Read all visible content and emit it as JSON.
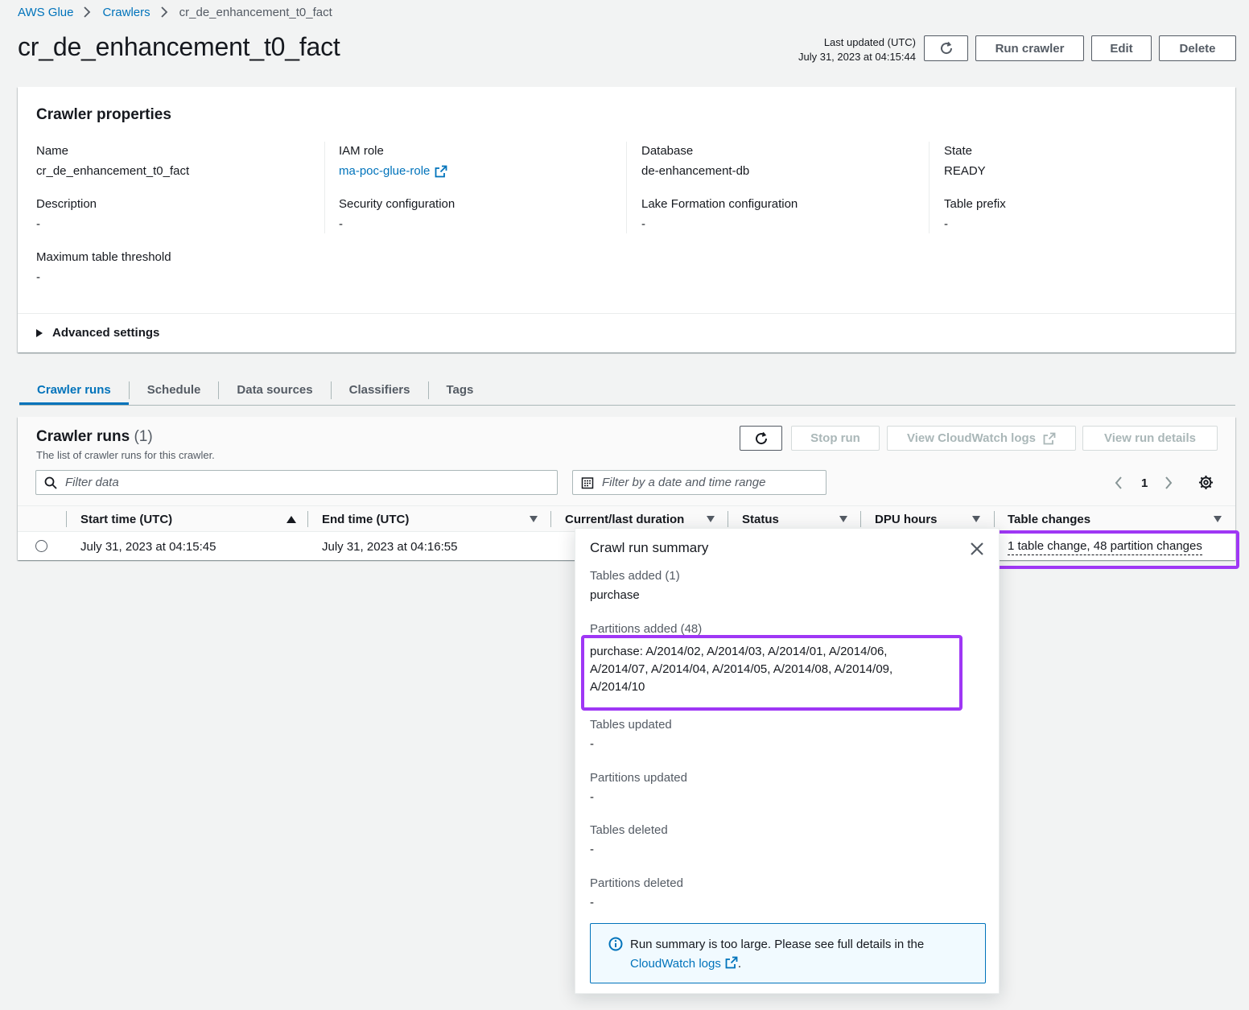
{
  "breadcrumb": {
    "root": "AWS Glue",
    "crawlers": "Crawlers",
    "current": "cr_de_enhancement_t0_fact"
  },
  "header": {
    "title": "cr_de_enhancement_t0_fact",
    "last_updated_label": "Last updated (UTC)",
    "last_updated_value": "July 31, 2023 at 04:15:44",
    "run_crawler": "Run crawler",
    "edit": "Edit",
    "delete": "Delete"
  },
  "properties": {
    "title": "Crawler properties",
    "name_label": "Name",
    "name_value": "cr_de_enhancement_t0_fact",
    "iam_label": "IAM role",
    "iam_value": "ma-poc-glue-role",
    "db_label": "Database",
    "db_value": "de-enhancement-db",
    "state_label": "State",
    "state_value": "READY",
    "desc_label": "Description",
    "desc_value": "-",
    "sec_label": "Security configuration",
    "sec_value": "-",
    "lf_label": "Lake Formation configuration",
    "lf_value": "-",
    "prefix_label": "Table prefix",
    "prefix_value": "-",
    "max_label": "Maximum table threshold",
    "max_value": "-",
    "advanced": "Advanced settings"
  },
  "tabs": [
    "Crawler runs",
    "Schedule",
    "Data sources",
    "Classifiers",
    "Tags"
  ],
  "runs": {
    "title": "Crawler runs",
    "count": "(1)",
    "description": "The list of crawler runs for this crawler.",
    "stop_run": "Stop run",
    "view_logs": "View CloudWatch logs",
    "view_details": "View run details",
    "filter_placeholder": "Filter data",
    "date_filter_placeholder": "Filter by a date and time range",
    "page": "1",
    "columns": [
      "Start time (UTC)",
      "End time (UTC)",
      "Current/last duration",
      "Status",
      "DPU hours",
      "Table changes"
    ],
    "row": {
      "start": "July 31, 2023 at 04:15:45",
      "end": "July 31, 2023 at 04:16:55",
      "changes": "1 table change, 48 partition changes"
    }
  },
  "popover": {
    "title": "Crawl run summary",
    "tables_added_label": "Tables added (1)",
    "tables_added_value": "purchase",
    "partitions_added_label": "Partitions added (48)",
    "partitions_added_value": "purchase: A/2014/02, A/2014/03, A/2014/01, A/2014/06, A/2014/07, A/2014/04, A/2014/05, A/2014/08, A/2014/09, A/2014/10",
    "tables_updated_label": "Tables updated",
    "tables_updated_value": "-",
    "partitions_updated_label": "Partitions updated",
    "partitions_updated_value": "-",
    "tables_deleted_label": "Tables deleted",
    "tables_deleted_value": "-",
    "partitions_deleted_label": "Partitions deleted",
    "partitions_deleted_value": "-",
    "alert_text": "Run summary is too large. Please see full details in the",
    "alert_link": "CloudWatch logs",
    "alert_end": "."
  },
  "colors": {
    "link": "#0073bb",
    "highlight": "#9f37f5",
    "text": "#16191f",
    "muted": "#545b64"
  }
}
